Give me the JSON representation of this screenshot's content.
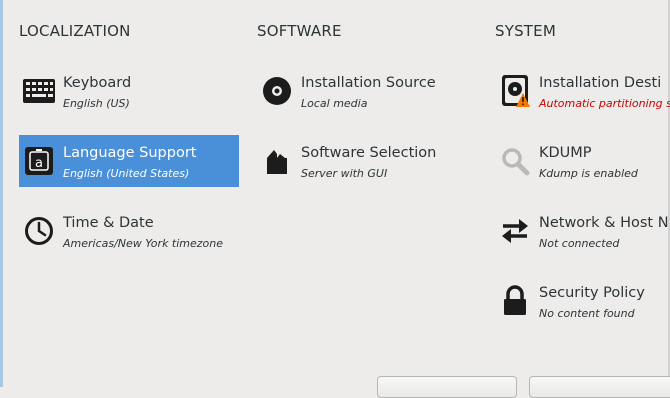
{
  "columns": {
    "localization": "LOCALIZATION",
    "software": "SOFTWARE",
    "system": "SYSTEM"
  },
  "spokes": {
    "keyboard": {
      "title": "Keyboard",
      "status": "English (US)",
      "icon": "keyboard-icon"
    },
    "language": {
      "title": "Language Support",
      "status": "English (United States)",
      "icon": "language-icon",
      "selected": true
    },
    "time_date": {
      "title": "Time & Date",
      "status": "Americas/New York timezone",
      "icon": "clock-icon"
    },
    "install_source": {
      "title": "Installation Source",
      "status": "Local media",
      "icon": "disc-icon"
    },
    "software_selection": {
      "title": "Software Selection",
      "status": "Server with GUI",
      "icon": "package-icon"
    },
    "install_dest": {
      "title": "Installation Desti",
      "status": "Automatic partitioning selec",
      "icon": "harddisk-warning-icon"
    },
    "kdump": {
      "title": "KDUMP",
      "status": "Kdump is enabled",
      "icon": "magnifier-icon"
    },
    "network": {
      "title": "Network & Host N",
      "status": "Not connected",
      "icon": "network-arrows-icon"
    },
    "security": {
      "title": "Security Policy",
      "status": "No content found",
      "icon": "lock-icon"
    }
  },
  "colors": {
    "selected": "#4a90d9",
    "warning": "#cc0000",
    "background": "#edeceb"
  }
}
